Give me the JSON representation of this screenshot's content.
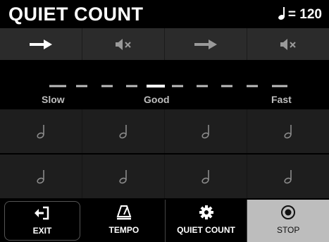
{
  "app": {
    "title": "QUIET COUNT",
    "tempo": "= 120",
    "tempo_icon": "quarter-note-icon"
  },
  "beats": [
    {
      "icon": "arrow-right-icon",
      "state": "active"
    },
    {
      "icon": "speaker-muted-icon",
      "state": "muted"
    },
    {
      "icon": "arrow-right-icon",
      "state": "inactive"
    },
    {
      "icon": "speaker-muted-icon",
      "state": "muted"
    }
  ],
  "meter": {
    "labels": {
      "slow": "Slow",
      "good": "Good",
      "fast": "Fast"
    }
  },
  "notes": {
    "rows": 2,
    "per_row": 4,
    "icon": "half-note-icon"
  },
  "toolbar": {
    "exit_label": "EXIT",
    "tempo_label": "TEMPO",
    "quiet_count_label": "QUIET COUNT",
    "stop_label": "STOP"
  },
  "colors": {
    "background": "#000000",
    "strip": "#2b2b2b",
    "grid": "#1e1e1e",
    "active": "#ffffff",
    "dim": "#9a9a9a",
    "stop_button": "#bdbdbd"
  }
}
